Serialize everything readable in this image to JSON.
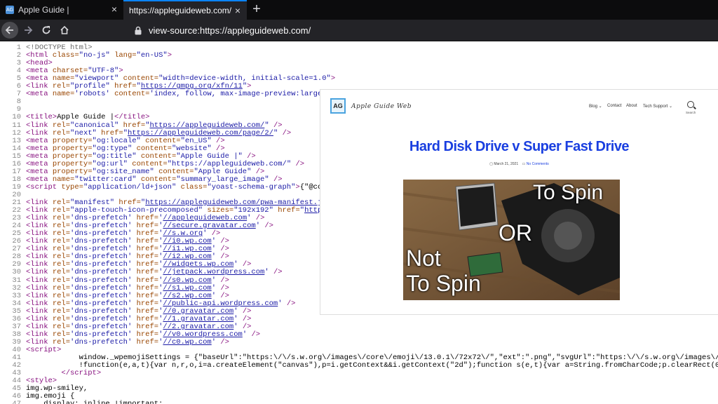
{
  "tabs": [
    {
      "label": "Apple Guide |",
      "active": false
    },
    {
      "label": "https://appleguideweb.com/",
      "active": true
    }
  ],
  "urlbar": {
    "url": "view-source:https://appleguideweb.com/"
  },
  "source_lines": [
    {
      "n": "1",
      "html": "<span class='cmt'>&lt;!DOCTYPE html&gt;</span>"
    },
    {
      "n": "2",
      "html": "<span class='tag'>&lt;html</span> <span class='attr'>class=</span><span class='val'>\"no-js\"</span> <span class='attr'>lang=</span><span class='val'>\"en-US\"</span><span class='tag'>&gt;</span>"
    },
    {
      "n": "3",
      "html": "<span class='tag'>&lt;head&gt;</span>"
    },
    {
      "n": "4",
      "html": "<span class='tag'>&lt;meta</span> <span class='attr'>charset=</span><span class='val'>\"UTF-8\"</span><span class='tag'>&gt;</span>"
    },
    {
      "n": "5",
      "html": "<span class='tag'>&lt;meta</span> <span class='attr'>name=</span><span class='val'>\"viewport\"</span> <span class='attr'>content=</span><span class='val'>\"width=device-width, initial-scale=1.0\"</span><span class='tag'>&gt;</span>"
    },
    {
      "n": "6",
      "html": "<span class='tag'>&lt;link</span> <span class='attr'>rel=</span><span class='val'>\"profile\"</span> <span class='attr'>href=</span><span class='val'>\"</span><span class='link'>https://gmpg.org/xfn/11</span><span class='val'>\"</span><span class='tag'>&gt;</span>"
    },
    {
      "n": "7",
      "html": "<span class='tag'>&lt;meta</span> <span class='attr'>name=</span><span class='val'>'robots'</span> <span class='attr'>content=</span><span class='val'>'index, follow, max-image-preview:large,</span>"
    },
    {
      "n": "8",
      "html": ""
    },
    {
      "n": "9",
      "html": ""
    },
    {
      "n": "10",
      "html": "<span class='tag'>&lt;title&gt;</span><span class='plain'>Apple Guide |</span><span class='tag'>&lt;/title&gt;</span>"
    },
    {
      "n": "11",
      "html": "<span class='tag'>&lt;link</span> <span class='attr'>rel=</span><span class='val'>\"canonical\"</span> <span class='attr'>href=</span><span class='val'>\"</span><span class='link'>https://appleguideweb.com/</span><span class='val'>\"</span> <span class='tag'>/&gt;</span>"
    },
    {
      "n": "12",
      "html": "<span class='tag'>&lt;link</span> <span class='attr'>rel=</span><span class='val'>\"next\"</span> <span class='attr'>href=</span><span class='val'>\"</span><span class='link'>https://appleguideweb.com/page/2/</span><span class='val'>\"</span> <span class='tag'>/&gt;</span>"
    },
    {
      "n": "13",
      "html": "<span class='tag'>&lt;meta</span> <span class='attr'>property=</span><span class='val'>\"og:locale\"</span> <span class='attr'>content=</span><span class='val'>\"en_US\"</span> <span class='tag'>/&gt;</span>"
    },
    {
      "n": "14",
      "html": "<span class='tag'>&lt;meta</span> <span class='attr'>property=</span><span class='val'>\"og:type\"</span> <span class='attr'>content=</span><span class='val'>\"website\"</span> <span class='tag'>/&gt;</span>"
    },
    {
      "n": "15",
      "html": "<span class='tag'>&lt;meta</span> <span class='attr'>property=</span><span class='val'>\"og:title\"</span> <span class='attr'>content=</span><span class='val'>\"Apple Guide |\"</span> <span class='tag'>/&gt;</span>"
    },
    {
      "n": "16",
      "html": "<span class='tag'>&lt;meta</span> <span class='attr'>property=</span><span class='val'>\"og:url\"</span> <span class='attr'>content=</span><span class='val'>\"https://appleguideweb.com/\"</span> <span class='tag'>/&gt;</span>"
    },
    {
      "n": "17",
      "html": "<span class='tag'>&lt;meta</span> <span class='attr'>property=</span><span class='val'>\"og:site_name\"</span> <span class='attr'>content=</span><span class='val'>\"Apple Guide\"</span> <span class='tag'>/&gt;</span>"
    },
    {
      "n": "18",
      "html": "<span class='tag'>&lt;meta</span> <span class='attr'>name=</span><span class='val'>\"twitter:card\"</span> <span class='attr'>content=</span><span class='val'>\"summary_large_image\"</span> <span class='tag'>/&gt;</span>"
    },
    {
      "n": "19",
      "html": "<span class='tag'>&lt;script</span> <span class='attr'>type=</span><span class='val'>\"application/ld+json\"</span> <span class='attr'>class=</span><span class='val'>\"yoast-schema-graph\"</span><span class='tag'>&gt;</span><span class='plain'>{\"@cont</span>"
    },
    {
      "n": "20",
      "html": ""
    },
    {
      "n": "21",
      "html": "<span class='tag'>&lt;link</span> <span class='attr'>rel=</span><span class='val'>\"manifest\"</span> <span class='attr'>href=</span><span class='val'>\"</span><span class='link'>https://appleguideweb.com/pwa-manifest.jsc</span>"
    },
    {
      "n": "22",
      "html": "<span class='tag'>&lt;link</span> <span class='attr'>rel=</span><span class='val'>\"apple-touch-icon-precomposed\"</span> <span class='attr'>sizes=</span><span class='val'>\"192x192\"</span> <span class='attr'>href=</span><span class='val'>\"</span><span class='link'>https:</span>"
    },
    {
      "n": "23",
      "html": "<span class='tag'>&lt;link</span> <span class='attr'>rel=</span><span class='val'>'dns-prefetch'</span> <span class='attr'>href=</span><span class='val'>'</span><span class='link'>//appleguideweb.com</span><span class='val'>'</span> <span class='tag'>/&gt;</span>"
    },
    {
      "n": "24",
      "html": "<span class='tag'>&lt;link</span> <span class='attr'>rel=</span><span class='val'>'dns-prefetch'</span> <span class='attr'>href=</span><span class='val'>'</span><span class='link'>//secure.gravatar.com</span><span class='val'>'</span> <span class='tag'>/&gt;</span>"
    },
    {
      "n": "25",
      "html": "<span class='tag'>&lt;link</span> <span class='attr'>rel=</span><span class='val'>'dns-prefetch'</span> <span class='attr'>href=</span><span class='val'>'</span><span class='link'>//s.w.org</span><span class='val'>'</span> <span class='tag'>/&gt;</span>"
    },
    {
      "n": "26",
      "html": "<span class='tag'>&lt;link</span> <span class='attr'>rel=</span><span class='val'>'dns-prefetch'</span> <span class='attr'>href=</span><span class='val'>'</span><span class='link'>//i0.wp.com</span><span class='val'>'</span> <span class='tag'>/&gt;</span>"
    },
    {
      "n": "27",
      "html": "<span class='tag'>&lt;link</span> <span class='attr'>rel=</span><span class='val'>'dns-prefetch'</span> <span class='attr'>href=</span><span class='val'>'</span><span class='link'>//i1.wp.com</span><span class='val'>'</span> <span class='tag'>/&gt;</span>"
    },
    {
      "n": "28",
      "html": "<span class='tag'>&lt;link</span> <span class='attr'>rel=</span><span class='val'>'dns-prefetch'</span> <span class='attr'>href=</span><span class='val'>'</span><span class='link'>//i2.wp.com</span><span class='val'>'</span> <span class='tag'>/&gt;</span>"
    },
    {
      "n": "29",
      "html": "<span class='tag'>&lt;link</span> <span class='attr'>rel=</span><span class='val'>'dns-prefetch'</span> <span class='attr'>href=</span><span class='val'>'</span><span class='link'>//widgets.wp.com</span><span class='val'>'</span> <span class='tag'>/&gt;</span>"
    },
    {
      "n": "30",
      "html": "<span class='tag'>&lt;link</span> <span class='attr'>rel=</span><span class='val'>'dns-prefetch'</span> <span class='attr'>href=</span><span class='val'>'</span><span class='link'>//jetpack.wordpress.com</span><span class='val'>'</span> <span class='tag'>/&gt;</span>"
    },
    {
      "n": "31",
      "html": "<span class='tag'>&lt;link</span> <span class='attr'>rel=</span><span class='val'>'dns-prefetch'</span> <span class='attr'>href=</span><span class='val'>'</span><span class='link'>//s0.wp.com</span><span class='val'>'</span> <span class='tag'>/&gt;</span>"
    },
    {
      "n": "32",
      "html": "<span class='tag'>&lt;link</span> <span class='attr'>rel=</span><span class='val'>'dns-prefetch'</span> <span class='attr'>href=</span><span class='val'>'</span><span class='link'>//s1.wp.com</span><span class='val'>'</span> <span class='tag'>/&gt;</span>"
    },
    {
      "n": "33",
      "html": "<span class='tag'>&lt;link</span> <span class='attr'>rel=</span><span class='val'>'dns-prefetch'</span> <span class='attr'>href=</span><span class='val'>'</span><span class='link'>//s2.wp.com</span><span class='val'>'</span> <span class='tag'>/&gt;</span>"
    },
    {
      "n": "34",
      "html": "<span class='tag'>&lt;link</span> <span class='attr'>rel=</span><span class='val'>'dns-prefetch'</span> <span class='attr'>href=</span><span class='val'>'</span><span class='link'>//public-api.wordpress.com</span><span class='val'>'</span> <span class='tag'>/&gt;</span>"
    },
    {
      "n": "35",
      "html": "<span class='tag'>&lt;link</span> <span class='attr'>rel=</span><span class='val'>'dns-prefetch'</span> <span class='attr'>href=</span><span class='val'>'</span><span class='link'>//0.gravatar.com</span><span class='val'>'</span> <span class='tag'>/&gt;</span>"
    },
    {
      "n": "36",
      "html": "<span class='tag'>&lt;link</span> <span class='attr'>rel=</span><span class='val'>'dns-prefetch'</span> <span class='attr'>href=</span><span class='val'>'</span><span class='link'>//1.gravatar.com</span><span class='val'>'</span> <span class='tag'>/&gt;</span>"
    },
    {
      "n": "37",
      "html": "<span class='tag'>&lt;link</span> <span class='attr'>rel=</span><span class='val'>'dns-prefetch'</span> <span class='attr'>href=</span><span class='val'>'</span><span class='link'>//2.gravatar.com</span><span class='val'>'</span> <span class='tag'>/&gt;</span>"
    },
    {
      "n": "38",
      "html": "<span class='tag'>&lt;link</span> <span class='attr'>rel=</span><span class='val'>'dns-prefetch'</span> <span class='attr'>href=</span><span class='val'>'</span><span class='link'>//v0.wordpress.com</span><span class='val'>'</span> <span class='tag'>/&gt;</span>"
    },
    {
      "n": "39",
      "html": "<span class='tag'>&lt;link</span> <span class='attr'>rel=</span><span class='val'>'dns-prefetch'</span> <span class='attr'>href=</span><span class='val'>'</span><span class='link'>//c0.wp.com</span><span class='val'>'</span> <span class='tag'>/&gt;</span>"
    },
    {
      "n": "40",
      "html": "<span class='tag'>&lt;script&gt;</span>"
    },
    {
      "n": "41",
      "html": "<span class='plain'>            window._wpemojiSettings = {\"baseUrl\":\"https:\\/\\/s.w.org\\/images\\/core\\/emoji\\/13.0.1\\/72x72\\/\",\"ext\":\".png\",\"svgUrl\":\"https:\\/\\/s.w.org\\/images\\/core</span>"
    },
    {
      "n": "42",
      "html": "<span class='plain'>            !function(e,a,t){var n,r,o,i=a.createElement(\"canvas\"),p=i.getContext&amp;&amp;i.getContext(\"2d\");function s(e,t){var a=String.fromCharCode;p.clearRect(0,0,i</span>"
    },
    {
      "n": "43",
      "html": "<span class='tag'>        &lt;/script&gt;</span>"
    },
    {
      "n": "44",
      "html": "<span class='tag'>&lt;style&gt;</span>"
    },
    {
      "n": "45",
      "html": "<span class='plain'>img.wp-smiley,</span>"
    },
    {
      "n": "46",
      "html": "<span class='plain'>img.emoji {</span>"
    },
    {
      "n": "47",
      "html": "<span class='plain'>    display: inline !important;</span>"
    }
  ],
  "preview": {
    "logo_text": "AG",
    "site_name": "Apple Guide Web",
    "menu": [
      "Blog ⌄",
      "Contact",
      "About",
      "Tech Support ⌄"
    ],
    "search_label": "Search",
    "post_title": "Hard Disk Drive v Super Fast Drive",
    "post_date": "March 21, 2021",
    "post_comments": "No Comments",
    "photo_text_1": "To Spin",
    "photo_text_2": "OR",
    "photo_text_3": "Not",
    "photo_text_4": "To Spin"
  }
}
